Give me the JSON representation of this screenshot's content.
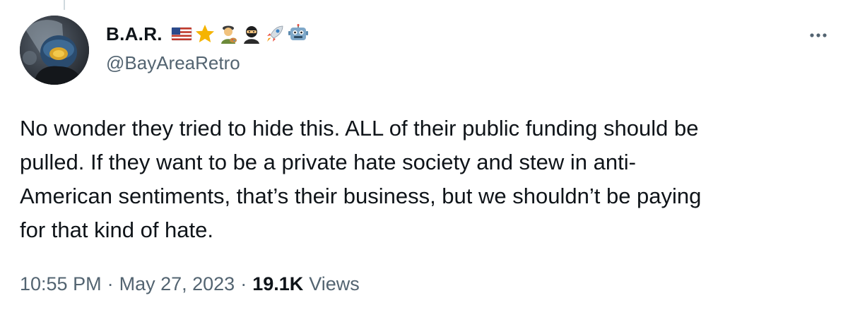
{
  "tweet": {
    "author": {
      "display_name": "B.A.R.",
      "name_emojis": [
        "us-flag-emoji",
        "star-emoji",
        "artist-emoji",
        "ninja-emoji",
        "rocket-emoji",
        "robot-emoji"
      ],
      "handle": "@BayAreaRetro"
    },
    "text_lines": [
      "No wonder they tried to hide this. ALL of their public funding should be",
      "pulled. If they want to be a private hate society and stew in anti-",
      "American sentiments, that’s their business, but we shouldn’t be paying",
      "for that kind of hate."
    ],
    "meta": {
      "time": "10:55 PM",
      "separator": "·",
      "date": "May 27, 2023",
      "views_count": "19.1K",
      "views_label": "Views"
    }
  },
  "colors": {
    "text_primary": "#0f1419",
    "text_secondary": "#536471",
    "border": "#cfd9de"
  }
}
